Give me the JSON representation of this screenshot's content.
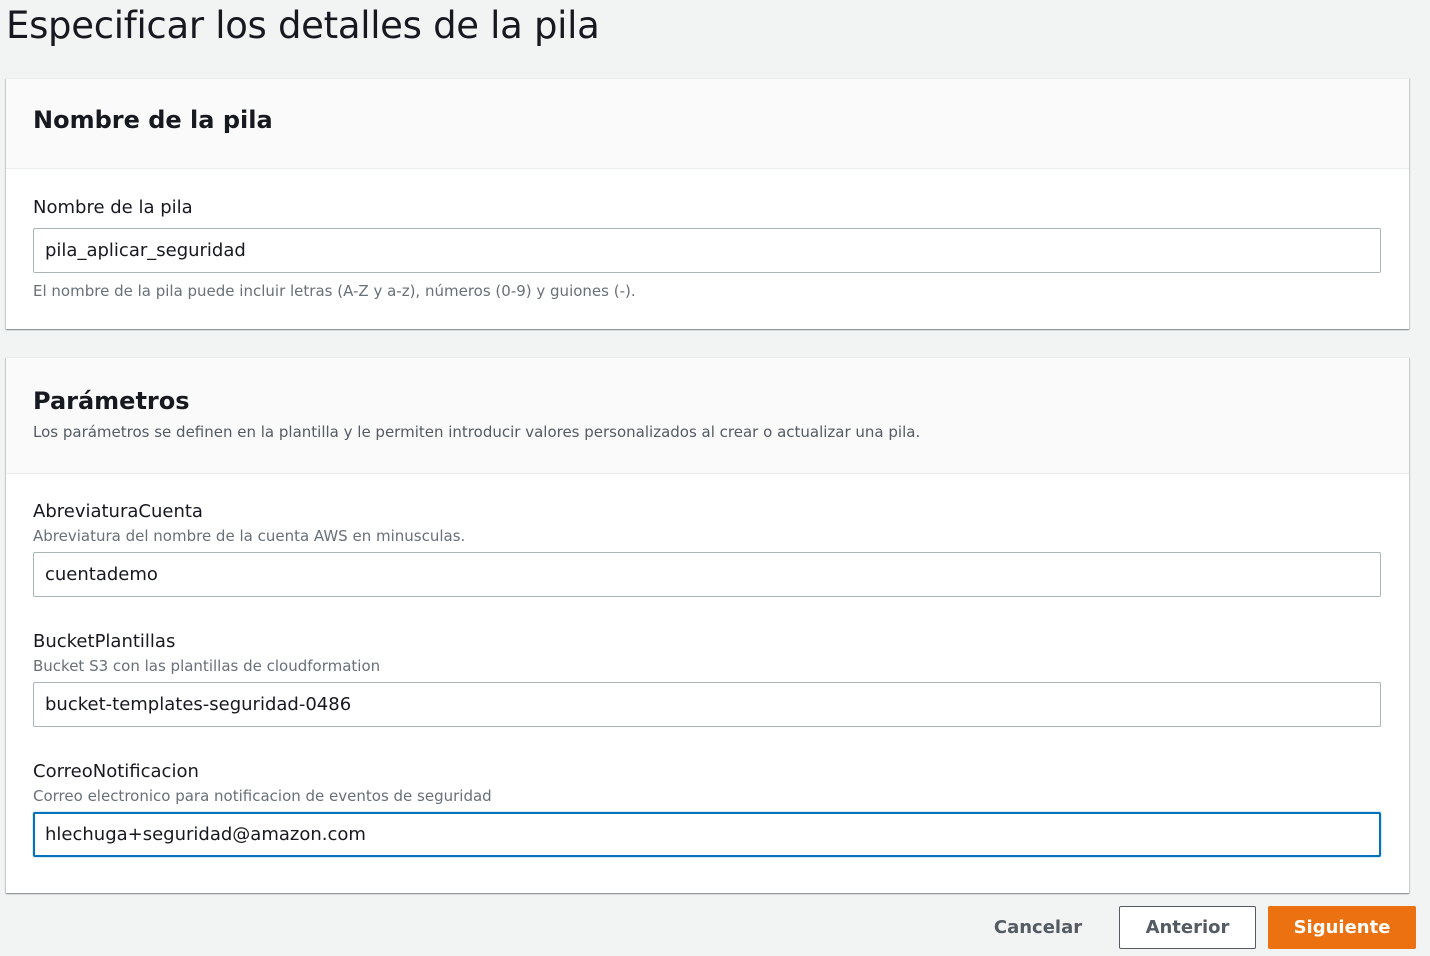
{
  "page": {
    "title": "Especificar los detalles de la pila"
  },
  "stack_name_panel": {
    "heading": "Nombre de la pila",
    "field_label": "Nombre de la pila",
    "field_value": "pila_aplicar_seguridad",
    "hint": "El nombre de la pila puede incluir letras (A-Z y a-z), números (0-9) y guiones (-)."
  },
  "parameters_panel": {
    "heading": "Parámetros",
    "description": "Los parámetros se definen en la plantilla y le permiten introducir valores personalizados al crear o actualizar una pila.",
    "fields": [
      {
        "label": "AbreviaturaCuenta",
        "description": "Abreviatura del nombre de la cuenta AWS en minusculas.",
        "value": "cuentademo"
      },
      {
        "label": "BucketPlantillas",
        "description": "Bucket S3 con las plantillas de cloudformation",
        "value": "bucket-templates-seguridad-0486"
      },
      {
        "label": "CorreoNotificacion",
        "description": "Correo electronico para notificacion de eventos de seguridad",
        "value": "hlechuga+seguridad@amazon.com"
      }
    ]
  },
  "actions": {
    "cancel_label": "Cancelar",
    "previous_label": "Anterior",
    "next_label": "Siguiente"
  },
  "colors": {
    "primary_button": "#ec7211",
    "focus_border": "#0073bb",
    "page_background": "#f2f3f3"
  }
}
